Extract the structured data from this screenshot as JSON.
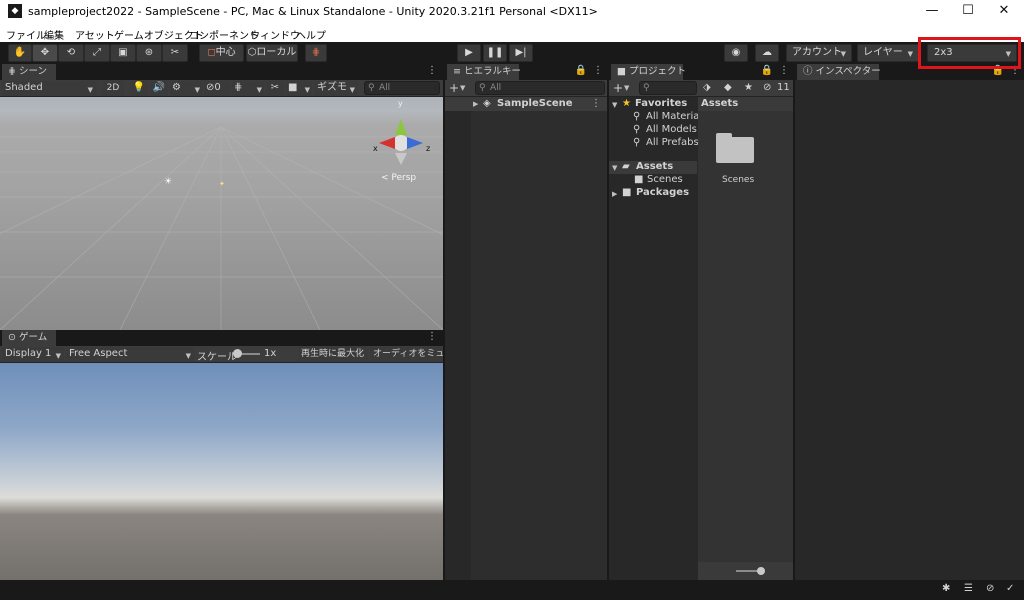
{
  "window": {
    "title": "sampleproject2022 - SampleScene - PC, Mac & Linux Standalone - Unity 2020.3.21f1 Personal <DX11>",
    "minimize": "—",
    "maximize": "☐",
    "close": "✕"
  },
  "menu": [
    "ファイル",
    "編集",
    "アセット",
    "ゲームオブジェクト",
    "コンポーネント",
    "ウィンドウ",
    "ヘルプ"
  ],
  "toolbar": {
    "pivot_label": "中心",
    "space_label": "ローカル",
    "account_label": "アカウント",
    "layers_label": "レイヤー",
    "layout_value": "2x3"
  },
  "scene": {
    "tab": "シーン",
    "shading_mode": "Shaded",
    "mode_2d": "2D",
    "hidden_count": "0",
    "gizmos_label": "ギズモ",
    "search_placeholder": "All",
    "persp_label": "< Persp",
    "axis_y": "y",
    "axis_x": "x",
    "axis_z": "z"
  },
  "game": {
    "tab": "ゲーム",
    "display": "Display 1",
    "aspect": "Free Aspect",
    "scale_label": "スケール",
    "scale_value": "1x",
    "maximize_on_play": "再生時に最大化",
    "mute_audio": "オーディオをミュート"
  },
  "hierarchy": {
    "tab": "ヒエラルキー",
    "search_placeholder": "All",
    "scene_item": "SampleScene"
  },
  "project": {
    "tab": "プロジェクト",
    "hidden_count": "11",
    "favorites_label": "Favorites",
    "favorites": [
      "All Materia",
      "All Models",
      "All Prefabs"
    ],
    "assets_label": "Assets",
    "scenes_label": "Scenes",
    "packages_label": "Packages",
    "content_header": "Assets",
    "folder_label": "Scenes"
  },
  "inspector": {
    "tab": "インスペクター"
  },
  "colors": {
    "highlight": "#e0141b",
    "gizmo_y": "#8cc63f",
    "gizmo_x": "#d4322f",
    "gizmo_z": "#3b6bd6"
  }
}
